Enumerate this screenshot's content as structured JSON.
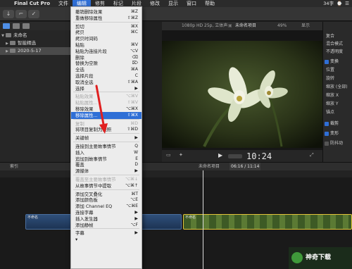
{
  "menubar": {
    "app_name": "Final Cut Pro",
    "items": [
      "文件",
      "编辑",
      "修剪",
      "标记",
      "片段",
      "修改",
      "显示",
      "窗口",
      "帮助"
    ],
    "active_index": 1,
    "status": [
      "34字",
      "⌚",
      "☰"
    ]
  },
  "sidebar": {
    "library": "未命名",
    "items": [
      "智能精选",
      "2020-5-17"
    ]
  },
  "viewer": {
    "format_info": "1080p HD 25p, 立体声",
    "project_name": "未命名项目",
    "zoom": "49%",
    "view_menu": "显示",
    "timecode": "10:24"
  },
  "inspector": {
    "items": [
      "复合",
      "混合模式",
      "不透明度",
      "变换",
      "位置",
      "旋转",
      "缩放 (全部)",
      "缩放 X",
      "缩放 Y",
      "锚点",
      "裁剪",
      "变形",
      "防抖动"
    ],
    "checked": [
      "变换",
      "裁剪",
      "变形"
    ]
  },
  "timeline": {
    "index_label": "索引",
    "project_name": "未命名项目",
    "duration": "06:16 / 11:14",
    "clip_title": "不命名"
  },
  "edit_menu": {
    "items": [
      {
        "label": "撤销删除效果",
        "shortcut": "⌘Z",
        "disabled": false
      },
      {
        "label": "重做移除属性",
        "shortcut": "⇧⌘Z",
        "disabled": false
      },
      {
        "sep": true
      },
      {
        "label": "剪切",
        "shortcut": "⌘X",
        "disabled": false
      },
      {
        "label": "拷贝",
        "shortcut": "⌘C",
        "disabled": false
      },
      {
        "label": "拷贝时间码",
        "shortcut": "",
        "disabled": false
      },
      {
        "label": "粘贴",
        "shortcut": "⌘V",
        "disabled": false
      },
      {
        "label": "粘贴为连接片段",
        "shortcut": "⌥V",
        "disabled": false
      },
      {
        "label": "删除",
        "shortcut": "⌫",
        "disabled": false
      },
      {
        "label": "替换为空隙",
        "shortcut": "⌦",
        "disabled": false
      },
      {
        "label": "全选",
        "shortcut": "⌘A",
        "disabled": false
      },
      {
        "label": "选择片段",
        "shortcut": "C",
        "disabled": false
      },
      {
        "label": "取消全选",
        "shortcut": "⇧⌘A",
        "disabled": false
      },
      {
        "label": "选择",
        "shortcut": "▶",
        "disabled": false
      },
      {
        "sep": true
      },
      {
        "label": "粘贴效果",
        "shortcut": "⌥⌘V",
        "disabled": true
      },
      {
        "label": "粘贴属性...",
        "shortcut": "⇧⌘V",
        "disabled": true
      },
      {
        "label": "移除效果",
        "shortcut": "⌥⌘X",
        "disabled": false
      },
      {
        "label": "移除属性...",
        "shortcut": "⇧⌘X",
        "disabled": false,
        "highlight": true
      },
      {
        "sep": true
      },
      {
        "label": "复制",
        "shortcut": "⌘D",
        "disabled": true
      },
      {
        "label": "将项目复制为快照",
        "shortcut": "⇧⌘D",
        "disabled": false
      },
      {
        "sep": true
      },
      {
        "label": "关键帧",
        "shortcut": "▶",
        "disabled": false
      },
      {
        "sep": true
      },
      {
        "label": "连接到主要故事情节",
        "shortcut": "Q",
        "disabled": false
      },
      {
        "label": "插入",
        "shortcut": "W",
        "disabled": false
      },
      {
        "label": "追加到故事情节",
        "shortcut": "E",
        "disabled": false
      },
      {
        "label": "覆盖",
        "shortcut": "D",
        "disabled": false
      },
      {
        "label": "源媒体",
        "shortcut": "▶",
        "disabled": false
      },
      {
        "sep": true
      },
      {
        "label": "覆盖至主要故事情节",
        "shortcut": "⌥⌘↓",
        "disabled": true
      },
      {
        "label": "从故事情节中提取",
        "shortcut": "⌥⌘↑",
        "disabled": false
      },
      {
        "sep": true
      },
      {
        "label": "添加交叉叠化",
        "shortcut": "⌘T",
        "disabled": false
      },
      {
        "label": "添加颜色板",
        "shortcut": "⌥E",
        "disabled": false
      },
      {
        "label": "添加 Channel EQ",
        "shortcut": "⌥⌘E",
        "disabled": false
      },
      {
        "label": "连接字幕",
        "shortcut": "▶",
        "disabled": false
      },
      {
        "label": "插入发生器",
        "shortcut": "▶",
        "disabled": false
      },
      {
        "label": "添加静帧",
        "shortcut": "⌥F",
        "disabled": false
      },
      {
        "sep": true
      },
      {
        "label": "字幕",
        "shortcut": "▶",
        "disabled": false
      },
      {
        "label": "▾",
        "shortcut": "",
        "disabled": false
      }
    ]
  },
  "watermark": "神奇下载"
}
